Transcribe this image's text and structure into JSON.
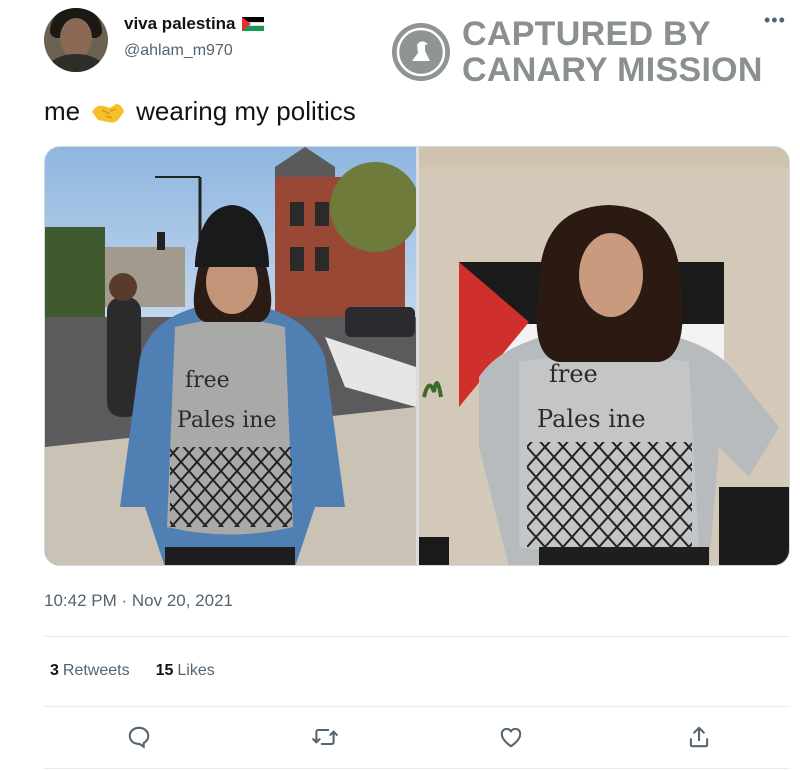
{
  "user": {
    "display_name": "viva palestina",
    "handle": "@ahlam_m970",
    "flag_icon": "palestine-flag-icon"
  },
  "watermark": {
    "line1": "CAPTURED BY",
    "line2": "CANARY MISSION"
  },
  "tweet": {
    "text_before": "me",
    "emoji_icon": "handshake-icon",
    "text_after": "wearing my politics",
    "timestamp": "10:42 PM · Nov 20, 2021"
  },
  "stats": {
    "retweets_count": "3",
    "retweets_label": "Retweets",
    "likes_count": "15",
    "likes_label": "Likes"
  },
  "media": {
    "shirt_text_line1": "free",
    "shirt_text_line2": "Pales ine"
  },
  "actions": [
    "reply-icon",
    "retweet-icon",
    "like-icon",
    "share-icon"
  ],
  "colors": {
    "text_primary": "#0f1419",
    "text_secondary": "#536471",
    "watermark": "#8a8f8f",
    "divider": "#e6ecf0"
  }
}
